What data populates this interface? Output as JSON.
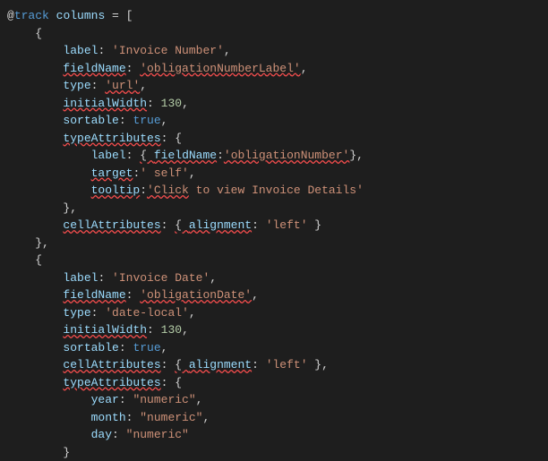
{
  "line1": {
    "at": "@",
    "track": "track",
    "columns": "columns",
    "eq": " = [",
    "indent": ""
  },
  "line2": {
    "indent": "    ",
    "brace": "{"
  },
  "line3": {
    "indent": "        ",
    "prop": "label",
    "colon": ": ",
    "val": "'Invoice Number'",
    "comma": ","
  },
  "line4": {
    "indent": "        ",
    "prop": "fieldName",
    "colon": ": ",
    "val": "'obligationNumberLabel'",
    "comma": ","
  },
  "line5": {
    "indent": "        ",
    "prop": "type",
    "colon": ": ",
    "val": "'url'",
    "comma": ","
  },
  "line6": {
    "indent": "        ",
    "prop": "initialWidth",
    "colon": ": ",
    "val": "130",
    "comma": ","
  },
  "line7": {
    "indent": "        ",
    "prop": "sortable",
    "colon": ": ",
    "val": "true",
    "comma": ","
  },
  "line8": {
    "indent": "        ",
    "prop": "typeAttributes",
    "colon": ": {"
  },
  "line9": {
    "indent": "            ",
    "prop": "label",
    "colon": ": ",
    "brace1": "{ ",
    "prop2": "fieldName",
    "colon2": ":",
    "val": "'obligationNumber'",
    "brace2": "}",
    "comma": ","
  },
  "line10": {
    "indent": "            ",
    "prop": "target",
    "colon": ":",
    "val": "' self'",
    "comma": ","
  },
  "line11": {
    "indent": "            ",
    "prop": "tooltip",
    "colon": ":",
    "val1": "'Click",
    "val2": " to view Invoice Details'"
  },
  "line12": {
    "indent": "        ",
    "brace": "},"
  },
  "line13": {
    "indent": "        ",
    "prop": "cellAttributes",
    "colon": ": ",
    "brace1": "{ ",
    "prop2": "alignment",
    "colon2": ": ",
    "val": "'left'",
    "brace2": " }"
  },
  "line14": {
    "indent": "    ",
    "brace": "},"
  },
  "line15": {
    "indent": "    ",
    "brace": "{"
  },
  "line16": {
    "indent": ""
  },
  "line17": {
    "indent": "        ",
    "prop": "label",
    "colon": ": ",
    "val": "'Invoice Date'",
    "comma": ","
  },
  "line18": {
    "indent": "        ",
    "prop": "fieldName",
    "colon": ": ",
    "val": "'obligationDate'",
    "comma": ","
  },
  "line19": {
    "indent": "        ",
    "prop": "type",
    "colon": ": ",
    "val": "'date-local'",
    "comma": ","
  },
  "line20": {
    "indent": "        ",
    "prop": "initialWidth",
    "colon": ": ",
    "val": "130",
    "comma": ","
  },
  "line21": {
    "indent": "        ",
    "prop": "sortable",
    "colon": ": ",
    "val": "true",
    "comma": ","
  },
  "line22": {
    "indent": "        ",
    "prop": "cellAttributes",
    "colon": ": ",
    "brace1": "{ ",
    "prop2": "alignment",
    "colon2": ": ",
    "val": "'left'",
    "brace2": " }",
    "comma": ","
  },
  "line23": {
    "indent": "        ",
    "prop": "typeAttributes",
    "colon": ": {"
  },
  "line24": {
    "indent": "            ",
    "prop": "year",
    "colon": ": ",
    "val": "\"numeric\"",
    "comma": ","
  },
  "line25": {
    "indent": "            ",
    "prop": "month",
    "colon": ": ",
    "val": "\"numeric\"",
    "comma": ","
  },
  "line26": {
    "indent": "            ",
    "prop": "day",
    "colon": ": ",
    "val": "\"numeric\""
  },
  "line27": {
    "indent": "        ",
    "brace": "}"
  }
}
